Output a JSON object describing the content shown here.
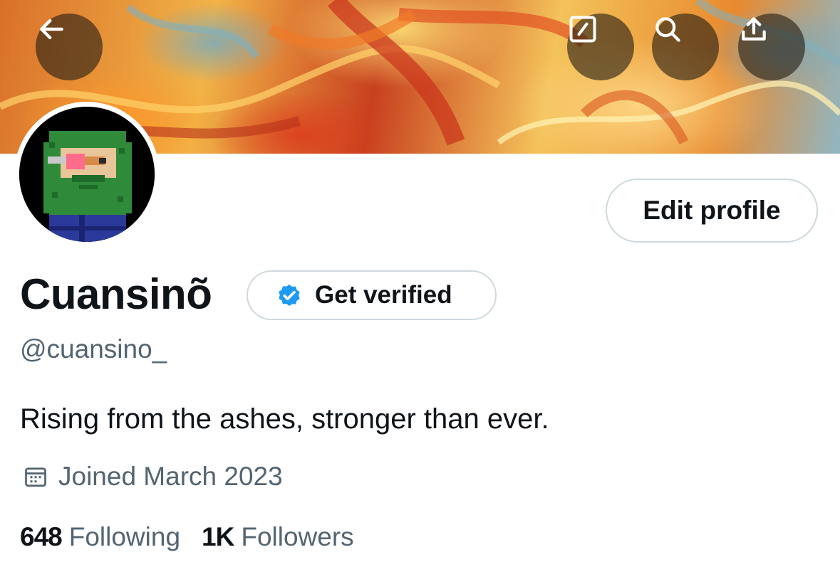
{
  "header": {
    "back_icon": "arrow-left-icon",
    "actions": [
      {
        "name": "compose-icon"
      },
      {
        "name": "search-icon"
      },
      {
        "name": "share-icon"
      }
    ]
  },
  "profile": {
    "display_name": "Cuansinõ",
    "handle": "@cuansino_",
    "bio": "Rising from the ashes, stronger than ever.",
    "joined": "Joined March 2023",
    "edit_profile_label": "Edit profile",
    "get_verified_label": "Get verified"
  },
  "stats": {
    "following_count": "648",
    "following_label": "Following",
    "followers_count": "1K",
    "followers_label": "Followers"
  },
  "colors": {
    "text_primary": "#0f1419",
    "text_secondary": "#536471",
    "border": "#cfd9de",
    "verified_blue": "#1d9bf0"
  }
}
